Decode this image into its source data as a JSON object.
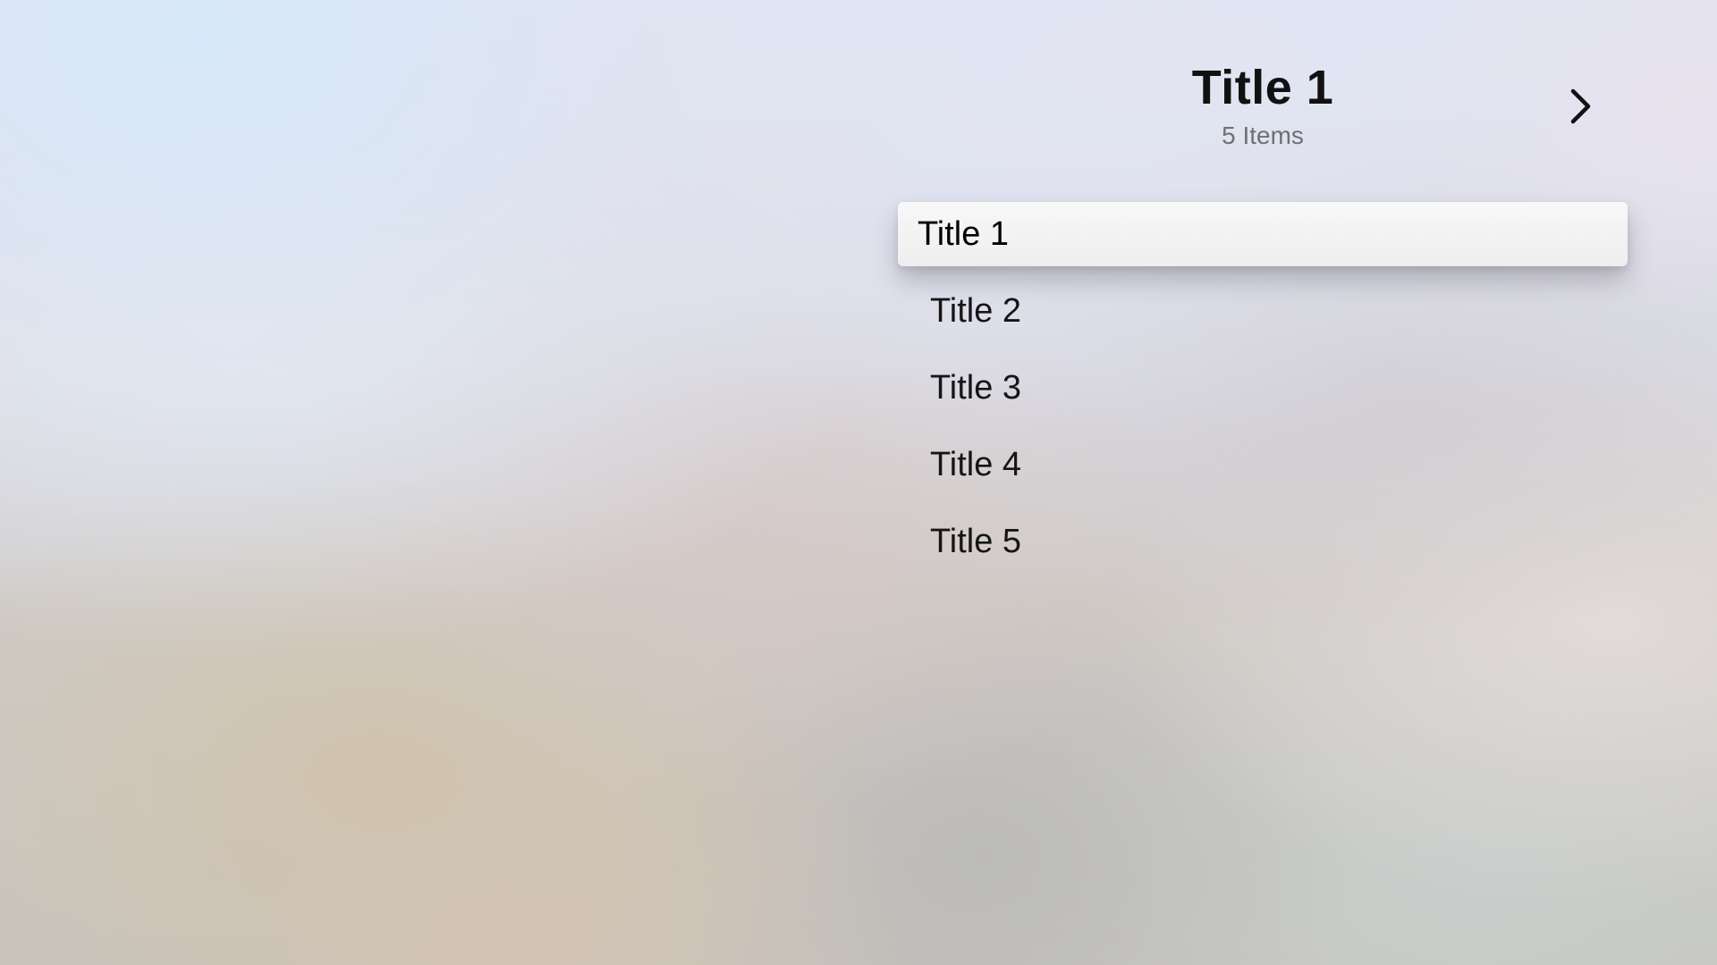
{
  "header": {
    "title": "Title 1",
    "subtitle": "5 Items",
    "next_icon": "chevron-right-icon"
  },
  "list": {
    "focused_index": 0,
    "items": [
      {
        "label": "Title 1"
      },
      {
        "label": "Title 2"
      },
      {
        "label": "Title 3"
      },
      {
        "label": "Title 4"
      },
      {
        "label": "Title 5"
      }
    ]
  }
}
